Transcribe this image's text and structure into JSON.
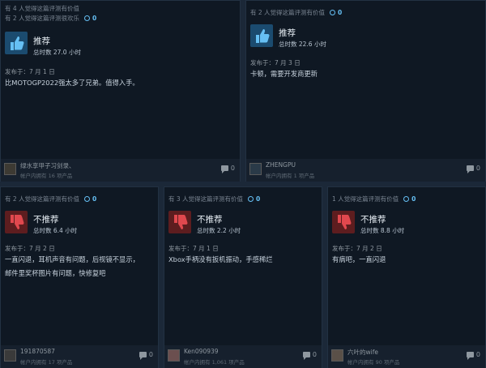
{
  "colors": {
    "recommended_bg": "#1b4b6f",
    "not_recommended_bg": "#5d1d1f",
    "award_accent": "#66c0f4"
  },
  "reviews": [
    {
      "helpful_lines": [
        "有 4 人觉得这篇评测有价值",
        "有 2 人觉得这篇评测很欢乐"
      ],
      "awards": "0",
      "icon": "thumbs-up-icon",
      "verdict": "推荐",
      "hours": "总时数 27.0 小时",
      "posted": "发布于：7 月 1 日",
      "body": [
        "比MOTOGP2022强太多了兄弟。值得入手。"
      ],
      "author": "绿水享甲子习剑录、",
      "owned": "帐户内拥有 16 项产品",
      "comments": "0"
    },
    {
      "helpful_lines": [
        "有 2 人觉得这篇评测有价值"
      ],
      "awards": "0",
      "icon": "thumbs-up-icon",
      "verdict": "推荐",
      "hours": "总时数 22.6 小时",
      "posted": "发布于：7 月 3 日",
      "body": [
        "卡顿，需要开发商更新"
      ],
      "author": "ZHENGPU",
      "owned": "帐户内拥有 1 项产品",
      "comments": "0"
    },
    {
      "helpful_lines": [
        "有 2 人觉得这篇评测有价值"
      ],
      "awards": "0",
      "icon": "thumbs-down-icon",
      "verdict": "不推荐",
      "hours": "总时数 6.4 小时",
      "posted": "发布于：7 月 2 日",
      "body": [
        "一直闪退，耳机声音有问题，后视镜不显示，",
        "邮件里奖杯图片有问题，快修复吧"
      ],
      "author": "191870587",
      "owned": "帐户内拥有 17 项产品",
      "comments": "0"
    },
    {
      "helpful_lines": [
        "有 3 人觉得这篇评测有价值"
      ],
      "awards": "0",
      "icon": "thumbs-down-icon",
      "verdict": "不推荐",
      "hours": "总时数 2.2 小时",
      "posted": "发布于：7 月 1 日",
      "body": [
        "Xbox手柄没有扳机振动，手感稀烂"
      ],
      "author": "Ken090939",
      "owned": "帐户内拥有 1,061 项产品",
      "comments": "0"
    },
    {
      "helpful_lines": [
        "1 人觉得这篇评测有价值"
      ],
      "awards": "0",
      "icon": "thumbs-down-icon",
      "verdict": "不推荐",
      "hours": "总时数 8.8 小时",
      "posted": "发布于：7 月 2 日",
      "body": [
        "有病吧，一直闪退"
      ],
      "author": "六叶的wife",
      "owned": "帐户内拥有 90 项产品",
      "comments": "0"
    }
  ]
}
